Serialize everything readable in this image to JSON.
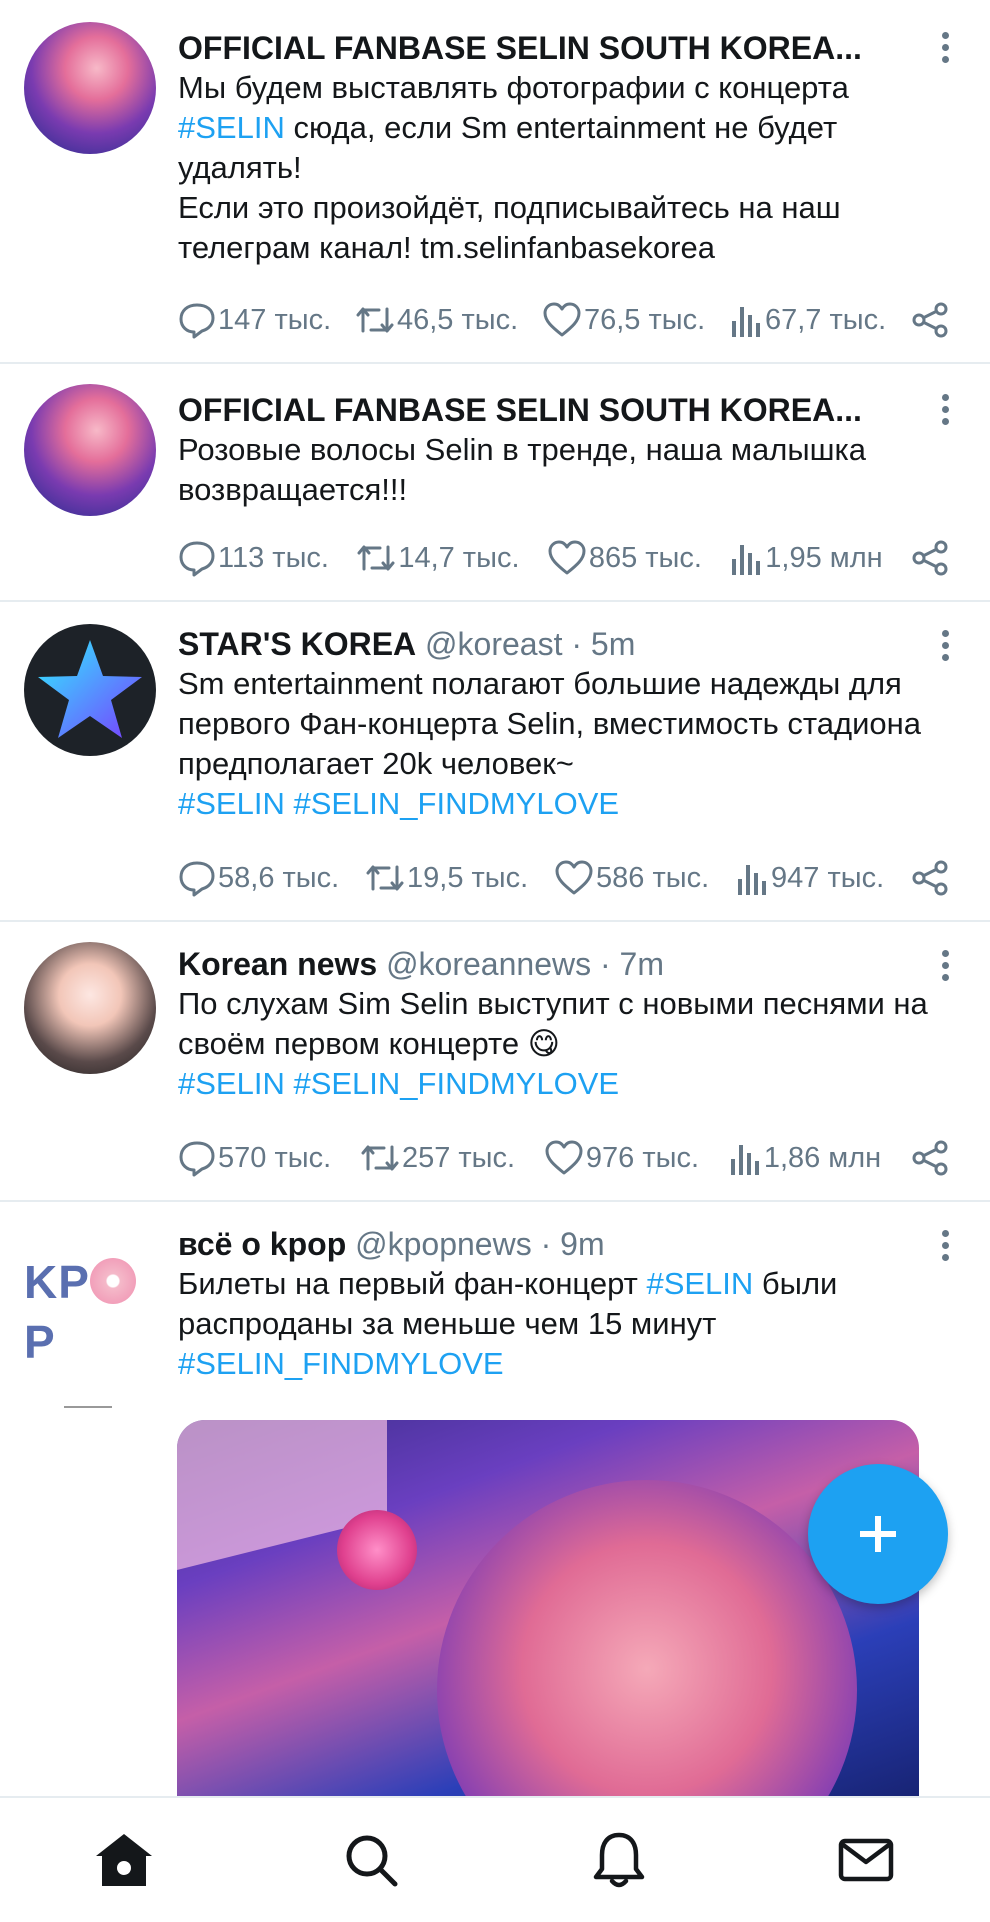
{
  "colors": {
    "accent": "#1da1f2",
    "muted": "#657786",
    "text": "#14171a"
  },
  "tweets": [
    {
      "name": "OFFICIAL FANBASE SELIN SOUTH KOREA...",
      "handle": "",
      "body": [
        {
          "t": "Мы будем выставлять фотографии с концерта\n"
        },
        {
          "t": "#SELIN",
          "tag": true
        },
        {
          "t": " сюда, если Sm entertainment не будет удалять!\nЕсли это произойдёт, подписывайтесь на наш телеграм канал! tm.selinfanbasekorea"
        }
      ],
      "replies": "147 тыс.",
      "retweets": "46,5 тыс.",
      "likes": "76,5 тыс.",
      "views": "67,7 тыс."
    },
    {
      "name": "OFFICIAL FANBASE SELIN SOUTH KOREA...",
      "handle": "",
      "body": [
        {
          "t": "Розовые волосы Selin в тренде, наша малышка возвращается!!!"
        }
      ],
      "replies": "113 тыс.",
      "retweets": "14,7 тыс.",
      "likes": "865 тыс.",
      "views": "1,95 млн"
    },
    {
      "name": "STAR'S KOREA",
      "handle": "@koreast · 5m",
      "body": [
        {
          "t": "Sm entertainment полагают большие надежды для первого Фан-концерта Selin, вместимость стадиона предполагает 20k человек~\n"
        },
        {
          "t": "#SELIN #SELIN_FINDMYLOVE",
          "tag": true
        }
      ],
      "replies": "58,6 тыс.",
      "retweets": "19,5 тыс.",
      "likes": "586 тыс.",
      "views": "947 тыс."
    },
    {
      "name": "Korean news",
      "handle": "@koreannews · 7m",
      "body": [
        {
          "t": "По слухам Sim Selin выступит с новыми песнями на своём первом концерте 😋\n"
        },
        {
          "t": "#SELIN #SELIN_FINDMYLOVE",
          "tag": true
        }
      ],
      "replies": "570 тыс.",
      "retweets": "257 тыс.",
      "likes": "976 тыс.",
      "views": "1,86 млн"
    },
    {
      "name": "всё о kpop",
      "handle": "@kpopnews · 9m",
      "body": [
        {
          "t": "Билеты на первый фан-концерт "
        },
        {
          "t": "#SELIN",
          "tag": true
        },
        {
          "t": " были распроданы за меньше чем 15 минут\n"
        },
        {
          "t": "#SELIN_FINDMYLOVE",
          "tag": true
        }
      ]
    }
  ],
  "kpop_logo": {
    "text": "KP",
    "tail": "P"
  },
  "icons": {
    "reply": "comment-icon",
    "retweet": "retweet-icon",
    "like": "heart-icon",
    "views": "views-icon",
    "share": "share-icon",
    "more": "more-vertical-icon",
    "fab": "plus-icon",
    "nav": [
      "home-icon",
      "search-icon",
      "bell-icon",
      "mail-icon"
    ]
  }
}
